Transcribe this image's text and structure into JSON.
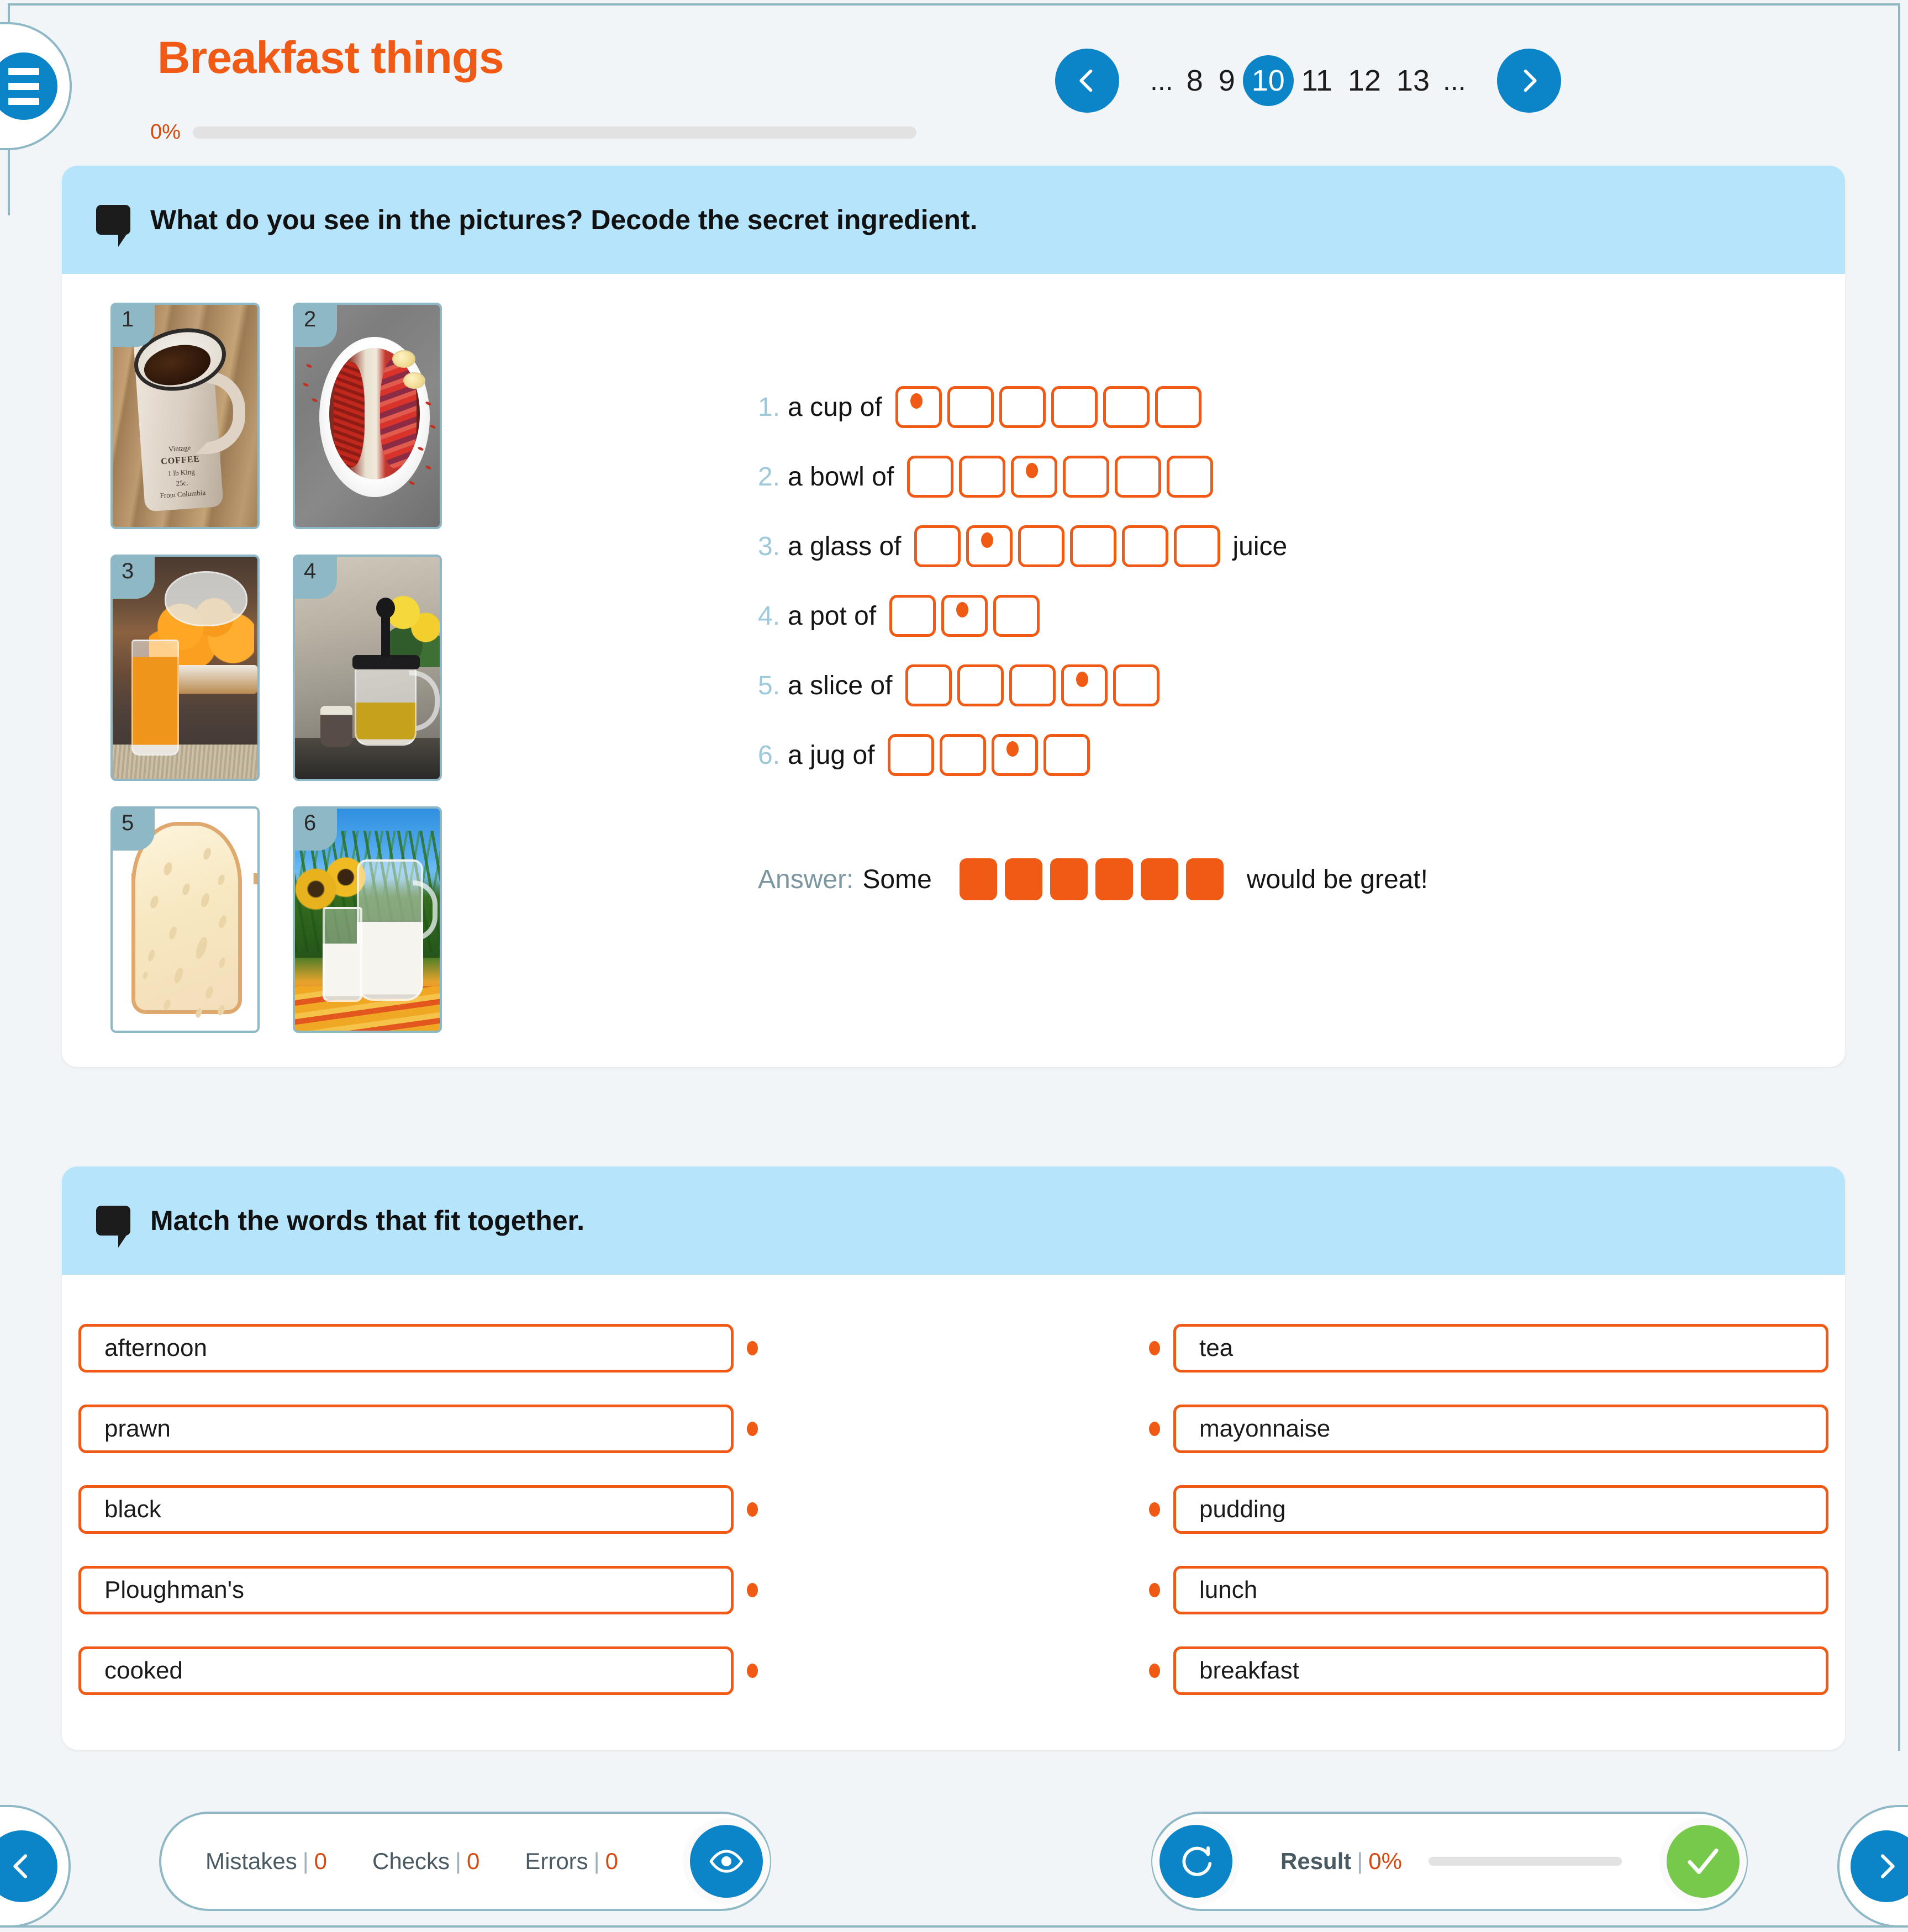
{
  "header": {
    "title": "Breakfast things",
    "menu_icon": "hamburger-menu-icon",
    "progress_percent": "0%",
    "progress_value": 0
  },
  "pagination": {
    "prev_icon": "chevron-left-icon",
    "next_icon": "chevron-right-icon",
    "pages": [
      "...",
      "8",
      "9",
      "10",
      "11",
      "12",
      "13",
      "..."
    ],
    "current": "10"
  },
  "exercise1": {
    "icon": "speech-bubble-icon",
    "instruction": "What do you see in the pictures? Decode the secret ingredient.",
    "pictures": [
      {
        "number": "1",
        "alt": "coffee mug on wooden table",
        "mug_line1": "Vintage",
        "mug_line2": "COFFEE",
        "mug_line3": "1 lb  King",
        "mug_line4": "25c.",
        "mug_line5": "From Columbia"
      },
      {
        "number": "2",
        "alt": "acai bowl with berries"
      },
      {
        "number": "3",
        "alt": "glass of orange juice with oranges"
      },
      {
        "number": "4",
        "alt": "teapot with green tea"
      },
      {
        "number": "5",
        "alt": "slice of bread"
      },
      {
        "number": "6",
        "alt": "jug and glass of milk in a field"
      }
    ],
    "rows": [
      {
        "num": "1.",
        "label": "a cup of",
        "boxes": 6,
        "dot_index": 0,
        "suffix": ""
      },
      {
        "num": "2.",
        "label": "a bowl of",
        "boxes": 6,
        "dot_index": 2,
        "suffix": ""
      },
      {
        "num": "3.",
        "label": "a glass of",
        "boxes": 6,
        "dot_index": 1,
        "suffix": "juice"
      },
      {
        "num": "4.",
        "label": "a pot of",
        "boxes": 3,
        "dot_index": 1,
        "suffix": ""
      },
      {
        "num": "5.",
        "label": "a slice of",
        "boxes": 5,
        "dot_index": 3,
        "suffix": ""
      },
      {
        "num": "6.",
        "label": "a jug of",
        "boxes": 4,
        "dot_index": 2,
        "suffix": ""
      }
    ],
    "answer": {
      "label": "Answer:",
      "prefix": "Some",
      "boxes": 6,
      "suffix": "would be great!"
    }
  },
  "exercise2": {
    "icon": "speech-bubble-icon",
    "instruction": "Match the words that fit together.",
    "left": [
      "afternoon",
      "prawn",
      "black",
      "Ploughman's",
      "cooked"
    ],
    "right": [
      "tea",
      "mayonnaise",
      "pudding",
      "lunch",
      "breakfast"
    ]
  },
  "footer": {
    "prev_icon": "chevron-left-icon",
    "next_icon": "chevron-right-icon",
    "stats": [
      {
        "label": "Mistakes",
        "value": "0"
      },
      {
        "label": "Checks",
        "value": "0"
      },
      {
        "label": "Errors",
        "value": "0"
      }
    ],
    "eye_icon": "eye-icon",
    "refresh_icon": "refresh-icon",
    "check_icon": "checkmark-icon",
    "result_label": "Result",
    "result_value": "0%",
    "result_progress": 0
  },
  "colors": {
    "accent_orange": "#f05a14",
    "accent_blue": "#0c85c8",
    "accent_green": "#76c94a",
    "header_blue": "#b6e4fb",
    "frame_blue": "#8fb8c6",
    "page_bg": "#f2f5f7"
  }
}
